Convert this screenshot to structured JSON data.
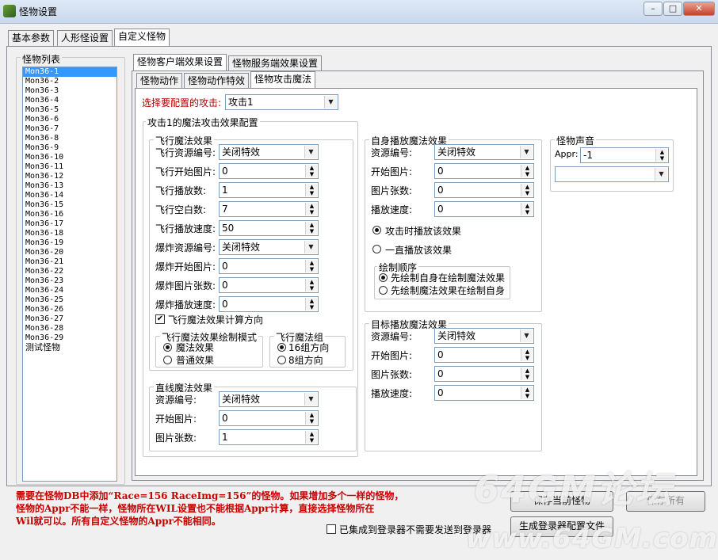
{
  "window": {
    "title": "怪物设置",
    "min": "–",
    "max": "□",
    "close": "✕",
    "icon": "app-icon"
  },
  "main_tabs": [
    "基本参数",
    "人形怪设置",
    "自定义怪物"
  ],
  "monster_list": {
    "title": "怪物列表",
    "items": [
      "Mon36-1",
      "Mon36-2",
      "Mon36-3",
      "Mon36-4",
      "Mon36-5",
      "Mon36-6",
      "Mon36-7",
      "Mon36-8",
      "Mon36-9",
      "Mon36-10",
      "Mon36-11",
      "Mon36-12",
      "Mon36-13",
      "Mon36-14",
      "Mon36-15",
      "Mon36-16",
      "Mon36-17",
      "Mon36-18",
      "Mon36-19",
      "Mon36-20",
      "Mon36-21",
      "Mon36-22",
      "Mon36-23",
      "Mon36-24",
      "Mon36-25",
      "Mon36-26",
      "Mon36-27",
      "Mon36-28",
      "Mon36-29",
      "测试怪物"
    ],
    "selected_index": 0
  },
  "effect_tabs": [
    "怪物客户端效果设置",
    "怪物服务端效果设置"
  ],
  "sub_tabs": [
    "怪物动作",
    "怪物动作特效",
    "怪物攻击魔法"
  ],
  "attack_select": {
    "label": "选择要配置的攻击:",
    "value": "攻击1"
  },
  "magic_config": {
    "title": "攻击1的魔法攻击效果配置",
    "flying": {
      "title": "飞行魔法效果",
      "fields": [
        {
          "label": "飞行资源编号:",
          "value": "关闭特效",
          "kind": "combo"
        },
        {
          "label": "飞行开始图片:",
          "value": "0",
          "kind": "spin"
        },
        {
          "label": "飞行播放数:",
          "value": "1",
          "kind": "spin"
        },
        {
          "label": "飞行空白数:",
          "value": "7",
          "kind": "spin"
        },
        {
          "label": "飞行播放速度:",
          "value": "50",
          "kind": "spin"
        },
        {
          "label": "爆炸资源编号:",
          "value": "关闭特效",
          "kind": "combo"
        },
        {
          "label": "爆炸开始图片:",
          "value": "0",
          "kind": "spin"
        },
        {
          "label": "爆炸图片张数:",
          "value": "0",
          "kind": "spin"
        },
        {
          "label": "爆炸播放速度:",
          "value": "0",
          "kind": "spin"
        }
      ],
      "calc_direction": {
        "label": "飞行魔法效果计算方向",
        "checked": true
      },
      "draw_mode": {
        "title": "飞行魔法效果绘制模式",
        "options": [
          "魔法效果",
          "普通效果"
        ],
        "selected": 0
      },
      "group": {
        "title": "飞行魔法组",
        "options": [
          "16组方向",
          "8组方向"
        ],
        "selected": 0
      }
    },
    "straight": {
      "title": "直线魔法效果",
      "fields": [
        {
          "label": "资源编号:",
          "value": "关闭特效",
          "kind": "combo"
        },
        {
          "label": "开始图片:",
          "value": "0",
          "kind": "spin"
        },
        {
          "label": "图片张数:",
          "value": "1",
          "kind": "spin"
        }
      ]
    },
    "self_play": {
      "title": "自身播放魔法效果",
      "fields": [
        {
          "label": "资源编号:",
          "value": "关闭特效",
          "kind": "combo"
        },
        {
          "label": "开始图片:",
          "value": "0",
          "kind": "spin"
        },
        {
          "label": "图片张数:",
          "value": "0",
          "kind": "spin"
        },
        {
          "label": "播放速度:",
          "value": "0",
          "kind": "spin"
        }
      ],
      "play_options": [
        "攻击时播放该效果",
        "一直播放该效果"
      ],
      "play_selected": 0,
      "draw_order": {
        "title": "绘制顺序",
        "options": [
          "先绘制自身在绘制魔法效果",
          "先绘制魔法效果在绘制自身"
        ],
        "selected": 0
      }
    },
    "target_play": {
      "title": "目标播放魔法效果",
      "fields": [
        {
          "label": "资源编号:",
          "value": "关闭特效",
          "kind": "combo"
        },
        {
          "label": "开始图片:",
          "value": "0",
          "kind": "spin"
        },
        {
          "label": "图片张数:",
          "value": "0",
          "kind": "spin"
        },
        {
          "label": "播放速度:",
          "value": "0",
          "kind": "spin"
        }
      ]
    },
    "sound": {
      "title": "怪物声音",
      "appr_label": "Appr:",
      "appr_value": "-1",
      "select_value": ""
    }
  },
  "note": [
    "需要在怪物DB中添加“Race=156 RaceImg=156”的怪物。如果增加多个一样的怪物，",
    "怪物的Appr不能一样，怪物所在WIL设置也不能根据Appr计算，直接选择怪物所在",
    "Wil就可以。所有自定义怪物的Appr不能相同。"
  ],
  "footer": {
    "integrated_checkbox": "已集成到登录器不需要发送到登录器",
    "save_current": "保存当前怪物",
    "save_all": "保存所有",
    "generate": "生成登录器配置文件"
  },
  "watermark": {
    "line1": "64GM论坛",
    "line2": "www.64GM.com"
  }
}
